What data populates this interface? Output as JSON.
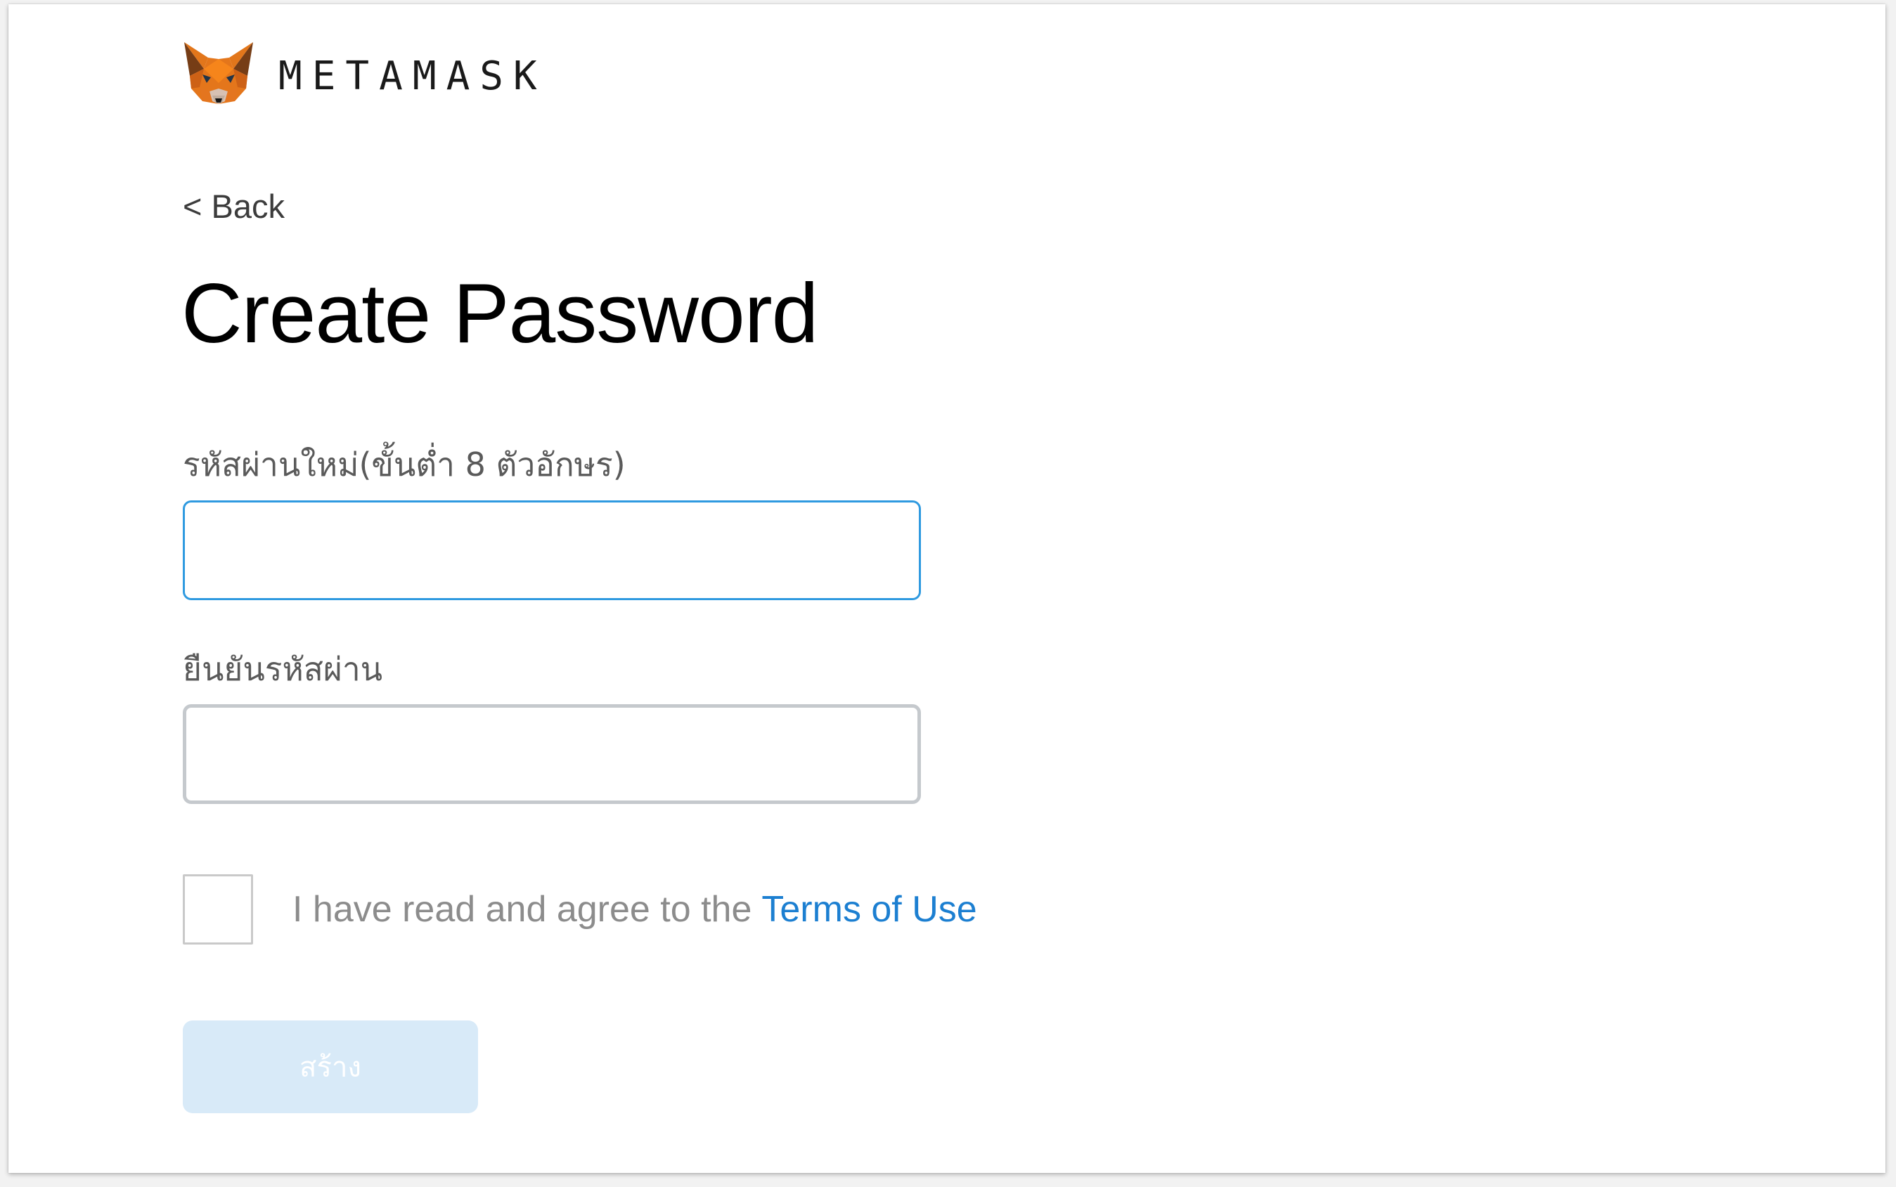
{
  "header": {
    "logo_icon": "metamask-fox-icon",
    "brand_name": "METAMASK"
  },
  "navigation": {
    "back_label": "< Back"
  },
  "page": {
    "title": "Create Password"
  },
  "form": {
    "new_password": {
      "label": "รหัสผ่านใหม่(ขั้นต่ำ 8 ตัวอักษร)",
      "value": ""
    },
    "confirm_password": {
      "label": "ยืนยันรหัสผ่าน",
      "value": ""
    },
    "terms": {
      "text": "I have read and agree to the",
      "link_label": "Terms of Use",
      "checked": false
    },
    "submit": {
      "label": "สร้าง",
      "enabled": false
    }
  },
  "colors": {
    "accent_link": "#1c7fd1",
    "focus_border": "#2f9ae0",
    "disabled_button_bg": "#d8eaf8",
    "fox_orange": "#e2761b"
  }
}
